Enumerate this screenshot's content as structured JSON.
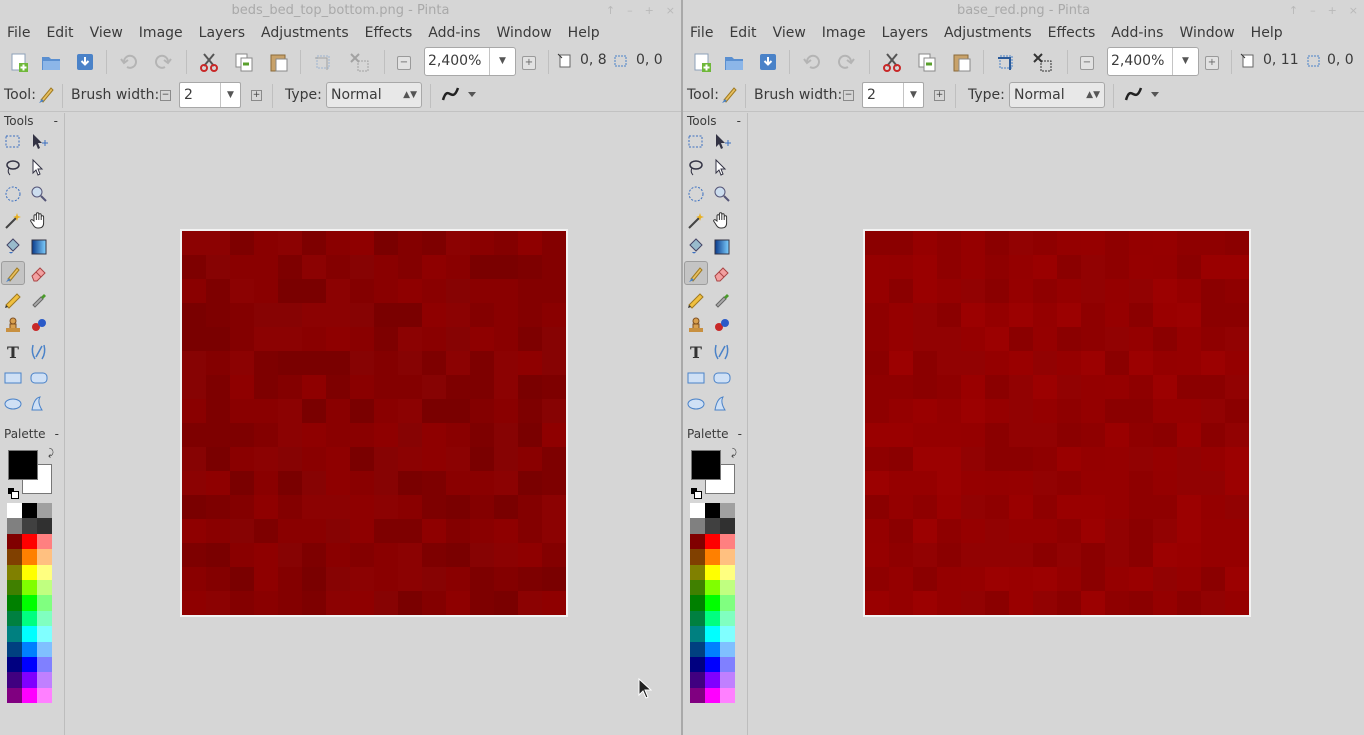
{
  "windows": [
    {
      "title": "beds_bed_top_bottom.png - Pinta",
      "cursor_pos": "0, 8",
      "selection_size": "0, 0"
    },
    {
      "title": "base_red.png - Pinta",
      "cursor_pos": "0, 11",
      "selection_size": "0, 0"
    }
  ],
  "menu": [
    "File",
    "Edit",
    "View",
    "Image",
    "Layers",
    "Adjustments",
    "Effects",
    "Add-ins",
    "Window",
    "Help"
  ],
  "toolbar": {
    "zoom": "2,400%"
  },
  "options": {
    "tool_label": "Tool:",
    "brush_width_label": "Brush width:",
    "brush_width_value": "2",
    "type_label": "Type:",
    "type_value": "Normal"
  },
  "docks": {
    "tools_title": "Tools",
    "palette_title": "Palette",
    "collapse": "-"
  },
  "tools": [
    "rectangle-select-icon",
    "move-selected-icon",
    "lasso-select-icon",
    "move-selection-icon",
    "ellipse-select-icon",
    "zoom-icon",
    "magic-wand-icon",
    "pan-icon",
    "paint-bucket-icon",
    "gradient-icon",
    "paintbrush-icon",
    "eraser-icon",
    "pencil-icon",
    "color-picker-icon",
    "clone-stamp-icon",
    "recolor-icon",
    "text-icon",
    "line-curve-icon",
    "rectangle-icon",
    "rounded-rectangle-icon",
    "ellipse-icon",
    "freeform-shape-icon"
  ],
  "palette_colors": [
    "#ffffff",
    "#000000",
    "#a0a0a0",
    "#808080",
    "#404040",
    "#303030",
    "#800000",
    "#ff0000",
    "#ff8080",
    "#804000",
    "#ff8000",
    "#ffc080",
    "#808000",
    "#ffff00",
    "#ffff80",
    "#408000",
    "#80ff00",
    "#c0ff80",
    "#008000",
    "#00ff00",
    "#80ff80",
    "#008040",
    "#00ff80",
    "#80ffc0",
    "#008080",
    "#00ffff",
    "#80ffff",
    "#004080",
    "#0080ff",
    "#80c0ff",
    "#000080",
    "#0000ff",
    "#8080ff",
    "#400080",
    "#8000ff",
    "#c080ff",
    "#800080",
    "#ff00ff",
    "#ff80ff"
  ],
  "canvas_palettes": {
    "left": [
      "#7e0000",
      "#840000",
      "#8a0000",
      "#8f0000",
      "#7a0000",
      "#870303",
      "#8c0202"
    ],
    "right": [
      "#950000",
      "#9a0000",
      "#8f0000",
      "#920202",
      "#9c0101",
      "#8b0000",
      "#960000"
    ]
  },
  "icons": {
    "minimize": "–",
    "maximize": "+",
    "close": "×",
    "up": "↑"
  }
}
